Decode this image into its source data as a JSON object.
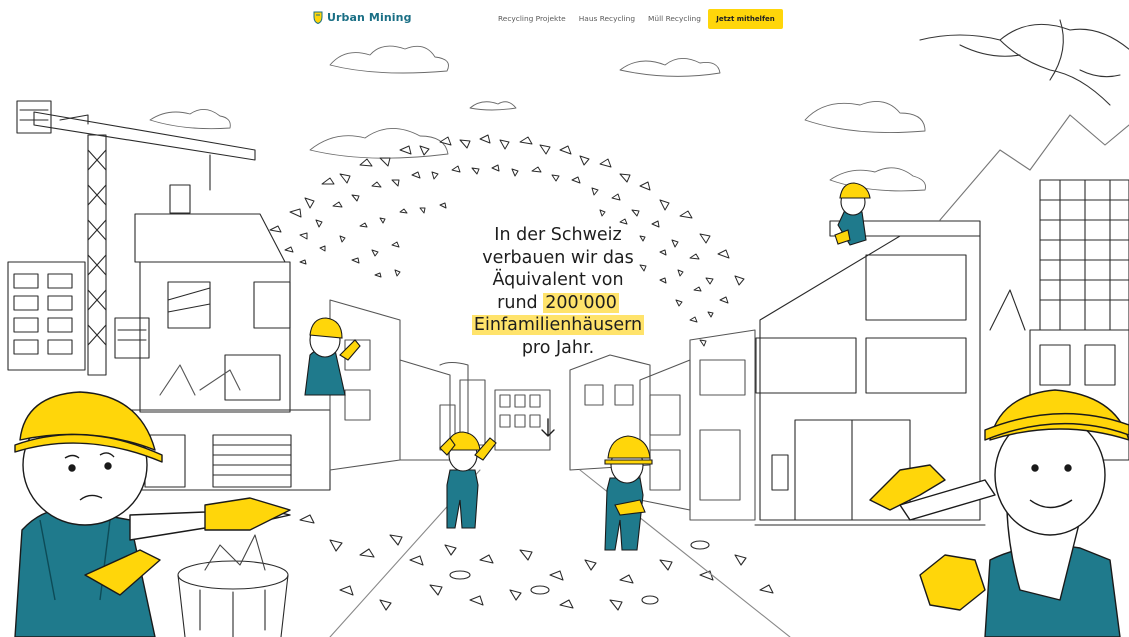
{
  "nav": {
    "logo_text": "Urban Mining",
    "links": [
      {
        "label": "Recycling Projekte"
      },
      {
        "label": "Haus Recycling"
      },
      {
        "label": "Müll Recycling"
      }
    ],
    "cta_label": "Jetzt mithelfen"
  },
  "hero": {
    "line1": "In der Schweiz",
    "line2": "verbauen wir das",
    "line3": "Äquivalent von",
    "line4_prefix": "rund ",
    "line4_highlight": "200'000",
    "line5_highlight": "Einfamilienhäusern",
    "line6": "pro Jahr."
  },
  "colors": {
    "brand_teal": "#1a6f85",
    "accent_yellow": "#ffd60a",
    "highlight_yellow": "#ffe36b",
    "worker_blue": "#1f7a8c",
    "ink": "#1e1e1e"
  },
  "icons": {
    "logo": "helmet-shield-icon",
    "scroll": "arrow-down-icon"
  }
}
